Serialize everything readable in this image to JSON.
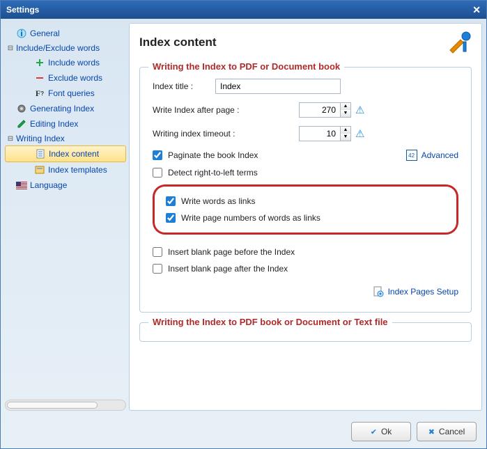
{
  "window": {
    "title": "Settings"
  },
  "sidebar": {
    "items": [
      {
        "label": "General"
      },
      {
        "label": "Include/Exclude words"
      },
      {
        "label": "Include words"
      },
      {
        "label": "Exclude words"
      },
      {
        "label": "Font queries"
      },
      {
        "label": "Generating Index"
      },
      {
        "label": "Editing Index"
      },
      {
        "label": "Writing Index"
      },
      {
        "label": "Index content"
      },
      {
        "label": "Index templates"
      },
      {
        "label": "Language"
      }
    ]
  },
  "content": {
    "heading": "Index content",
    "group1": {
      "title": "Writing the Index to PDF or Document book",
      "index_title_label": "Index title :",
      "index_title_value": "Index",
      "after_page_label": "Write Index after page :",
      "after_page_value": "270",
      "timeout_label": "Writing index timeout :",
      "timeout_value": "10",
      "paginate_label": "Paginate the book Index",
      "advanced_label": "Advanced",
      "cal_badge": "42",
      "rtl_label": "Detect right-to-left terms",
      "links_words_label": "Write words as links",
      "links_pages_label": "Write page numbers of words as links",
      "blank_before_label": "Insert blank page before the Index",
      "blank_after_label": "Insert blank page after the Index",
      "pages_setup_label": "Index Pages Setup"
    },
    "group2": {
      "title": "Writing the Index to PDF book or Document or Text file"
    }
  },
  "footer": {
    "ok": "Ok",
    "cancel": "Cancel"
  }
}
